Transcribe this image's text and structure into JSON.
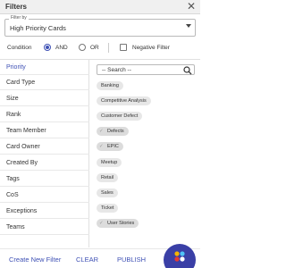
{
  "header": {
    "title": "Filters",
    "close_glyph": "✕"
  },
  "filter_by": {
    "legend": "Filter by",
    "value": "High Priority Cards"
  },
  "condition": {
    "label": "Condition",
    "options": [
      {
        "label": "AND",
        "selected": true
      },
      {
        "label": "OR",
        "selected": false
      }
    ],
    "negative_filter": {
      "label": "Negative Filter",
      "checked": false
    }
  },
  "left_list": {
    "items": [
      {
        "label": "Priority",
        "active": true
      },
      {
        "label": "Card Type",
        "active": false
      },
      {
        "label": "Size",
        "active": false
      },
      {
        "label": "Rank",
        "active": false
      },
      {
        "label": "Team Member",
        "active": false
      },
      {
        "label": "Card Owner",
        "active": false
      },
      {
        "label": "Created By",
        "active": false
      },
      {
        "label": "Tags",
        "active": false
      },
      {
        "label": "CoS",
        "active": false
      },
      {
        "label": "Exceptions",
        "active": false
      },
      {
        "label": "Teams",
        "active": false
      }
    ]
  },
  "right_pane": {
    "search_placeholder": "-- Search --",
    "tags": [
      {
        "label": "Banking",
        "selected": false
      },
      {
        "label": "Competitive Analysis",
        "selected": false
      },
      {
        "label": "Customer Defect",
        "selected": false
      },
      {
        "label": "Defects",
        "selected": true
      },
      {
        "label": "EPIC",
        "selected": true
      },
      {
        "label": "Meetup",
        "selected": false
      },
      {
        "label": "Retail",
        "selected": false
      },
      {
        "label": "Sales",
        "selected": false
      },
      {
        "label": "Ticket",
        "selected": false
      },
      {
        "label": "User Stories",
        "selected": true
      }
    ]
  },
  "footer": {
    "create": "Create New Filter",
    "clear": "CLEAR",
    "publish": "PUBLISH"
  },
  "colors": {
    "accent": "#3f51b5",
    "fab": "#3a3fa6",
    "tag_bg": "#e7e7e7"
  },
  "icons": {
    "search": "search-icon",
    "close": "close-icon",
    "fab": "app-logo-icon"
  }
}
